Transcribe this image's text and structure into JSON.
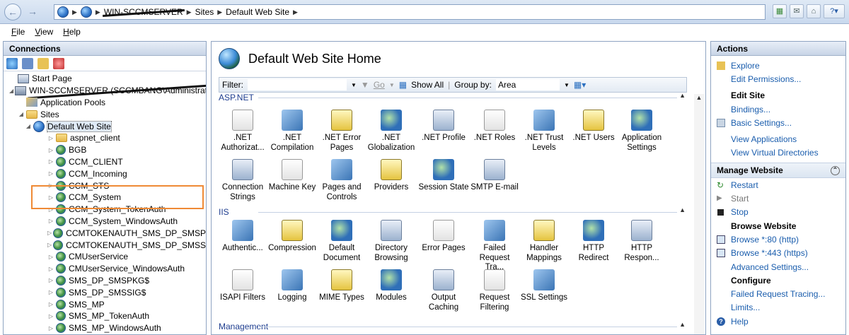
{
  "address": {
    "server": "WIN-SCCMSERVER",
    "crumb1": "Sites",
    "crumb2": "Default Web Site"
  },
  "menu": [
    "File",
    "View",
    "Help"
  ],
  "connections": {
    "title": "Connections",
    "tree": [
      {
        "label": "Start Page",
        "depth": 0,
        "icon": "start-page-icon",
        "arrow": ""
      },
      {
        "label": "WIN-SCCMSERVER (SCCMBANG\\Administrator)",
        "depth": 0,
        "icon": "server-icon",
        "arrow": "v",
        "redacted": true
      },
      {
        "label": "Application Pools",
        "depth": 1,
        "icon": "app-pools-icon",
        "arrow": ""
      },
      {
        "label": "Sites",
        "depth": 1,
        "icon": "folder-icon",
        "arrow": "v"
      },
      {
        "label": "Default Web Site",
        "depth": 2,
        "icon": "globe-icon",
        "arrow": "v",
        "selected": true
      },
      {
        "label": "aspnet_client",
        "depth": 3,
        "icon": "folder-icon",
        "arrow": ">"
      },
      {
        "label": "BGB",
        "depth": 3,
        "icon": "app-icon",
        "arrow": ">"
      },
      {
        "label": "CCM_CLIENT",
        "depth": 3,
        "icon": "app-icon",
        "arrow": ">"
      },
      {
        "label": "CCM_Incoming",
        "depth": 3,
        "icon": "app-icon",
        "arrow": ">"
      },
      {
        "label": "CCM_STS",
        "depth": 3,
        "icon": "app-icon",
        "arrow": ">"
      },
      {
        "label": "CCM_System",
        "depth": 3,
        "icon": "app-icon",
        "arrow": ">"
      },
      {
        "label": "CCM_System_TokenAuth",
        "depth": 3,
        "icon": "app-icon",
        "arrow": ">"
      },
      {
        "label": "CCM_System_WindowsAuth",
        "depth": 3,
        "icon": "app-icon",
        "arrow": ">"
      },
      {
        "label": "CCMTOKENAUTH_SMS_DP_SMSPKG$",
        "depth": 3,
        "icon": "app-icon",
        "arrow": ">"
      },
      {
        "label": "CCMTOKENAUTH_SMS_DP_SMSSIG$",
        "depth": 3,
        "icon": "app-icon",
        "arrow": ">"
      },
      {
        "label": "CMUserService",
        "depth": 3,
        "icon": "app-icon",
        "arrow": ">"
      },
      {
        "label": "CMUserService_WindowsAuth",
        "depth": 3,
        "icon": "app-icon",
        "arrow": ">"
      },
      {
        "label": "SMS_DP_SMSPKG$",
        "depth": 3,
        "icon": "app-icon",
        "arrow": ">"
      },
      {
        "label": "SMS_DP_SMSSIG$",
        "depth": 3,
        "icon": "app-icon",
        "arrow": ">"
      },
      {
        "label": "SMS_MP",
        "depth": 3,
        "icon": "app-icon",
        "arrow": ">"
      },
      {
        "label": "SMS_MP_TokenAuth",
        "depth": 3,
        "icon": "app-icon",
        "arrow": ">"
      },
      {
        "label": "SMS_MP_WindowsAuth",
        "depth": 3,
        "icon": "app-icon",
        "arrow": ">"
      }
    ]
  },
  "main": {
    "title": "Default Web Site Home",
    "filter_label": "Filter:",
    "go_label": "Go",
    "show_all_label": "Show All",
    "group_by_label": "Group by:",
    "group_by_value": "Area",
    "groups": [
      {
        "name": "ASP.NET",
        "features": [
          ".NET Authorizat...",
          ".NET Compilation",
          ".NET Error Pages",
          ".NET Globalization",
          ".NET Profile",
          ".NET Roles",
          ".NET Trust Levels",
          ".NET Users",
          "Application Settings",
          "Connection Strings",
          "Machine Key",
          "Pages and Controls",
          "Providers",
          "Session State",
          "SMTP E-mail"
        ]
      },
      {
        "name": "IIS",
        "features": [
          "Authentic...",
          "Compression",
          "Default Document",
          "Directory Browsing",
          "Error Pages",
          "Failed Request Tra...",
          "Handler Mappings",
          "HTTP Redirect",
          "HTTP Respon...",
          "ISAPI Filters",
          "Logging",
          "MIME Types",
          "Modules",
          "Output Caching",
          "Request Filtering",
          "SSL Settings"
        ]
      },
      {
        "name": "Management",
        "features": []
      }
    ]
  },
  "actions": {
    "title": "Actions",
    "explore": "Explore",
    "edit_permissions": "Edit Permissions...",
    "edit_site": "Edit Site",
    "bindings": "Bindings...",
    "basic_settings": "Basic Settings...",
    "view_applications": "View Applications",
    "view_vdirs": "View Virtual Directories",
    "manage_website": "Manage Website",
    "restart": "Restart",
    "start": "Start",
    "stop": "Stop",
    "browse_website": "Browse Website",
    "browse_80": "Browse *:80 (http)",
    "browse_443": "Browse *:443 (https)",
    "advanced_settings": "Advanced Settings...",
    "configure": "Configure",
    "failed_request_tracing": "Failed Request Tracing...",
    "limits": "Limits...",
    "help": "Help"
  }
}
